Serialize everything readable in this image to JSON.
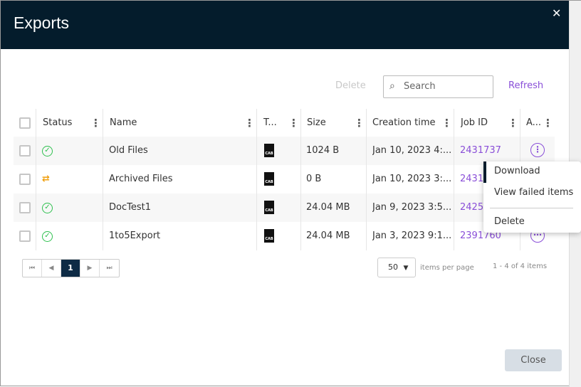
{
  "dialog": {
    "title": "Exports",
    "close_label": "Close"
  },
  "toolbar": {
    "delete_label": "Delete",
    "search_placeholder": "Search",
    "refresh_label": "Refresh"
  },
  "columns": [
    "Status",
    "Name",
    "T...",
    "Size",
    "Creation time",
    "Job ID",
    "A..."
  ],
  "rows": [
    {
      "status": "success",
      "name": "Old Files",
      "type": "CAB",
      "size": "1024 B",
      "created": "Jan 10, 2023 4:...",
      "job_id": "2431737"
    },
    {
      "status": "in-progress",
      "name": "Archived Files",
      "type": "CAB",
      "size": "0 B",
      "created": "Jan 10, 2023 3:...",
      "job_id": "24311"
    },
    {
      "status": "success",
      "name": "DocTest1",
      "type": "CAB",
      "size": "24.04 MB",
      "created": "Jan 9, 2023 3:5...",
      "job_id": "2425"
    },
    {
      "status": "success",
      "name": "1to5Export",
      "type": "CAB",
      "size": "24.04 MB",
      "created": "Jan 3, 2023 9:1...",
      "job_id": "2391760"
    }
  ],
  "context_menu": {
    "items": [
      "Download",
      "View failed items",
      "Delete"
    ]
  },
  "pagination": {
    "current_page": "1",
    "page_size": "50",
    "page_size_label": "items per page",
    "count": "1 - 4 of 4 items"
  },
  "colors": {
    "header": "#041c2c",
    "accent": "#8a4fd8",
    "success": "#2ec04e",
    "warning": "#f0a010"
  }
}
